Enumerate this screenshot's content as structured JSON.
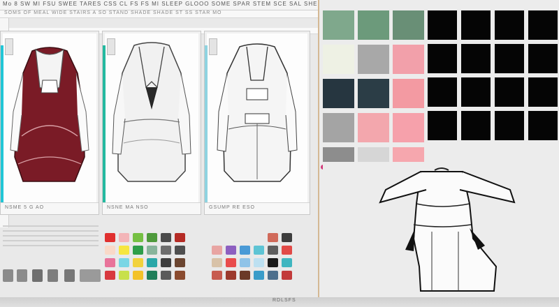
{
  "header": {
    "title_line": "Mo 8 SW MI FSU SWEE TARES CSS CL FS FS MI SLEEP GLOOO SOME SPAR STEM SCE SAL SHE",
    "subtitle_line": "SOMS OF MEAL WIDE STAIRS A SO STAND SHADE SHADE ST SS STAR MO"
  },
  "panels": [
    {
      "name": "burgundy-dress-sketch",
      "caption": "NSME 5 G AO",
      "accent": "#21c6d6",
      "fill": "#7a1b26"
    },
    {
      "name": "white-blazer-dress-sketch",
      "caption": "NSNE MA NSO",
      "accent": "#23b9a0",
      "fill": "#efefef"
    },
    {
      "name": "white-belted-dress-sketch",
      "caption": "GSUMP RE ESO",
      "accent": "#8fd3e0",
      "fill": "#f5f5f5"
    }
  ],
  "footer": {
    "label": "RDLSFS"
  },
  "palette_left": {
    "colors": [
      "#e0302f",
      "#f3b5b8",
      "#75c043",
      "#4f9a3c",
      "#4b4b4b",
      "#b52b25",
      "#f9d9c8",
      "#f6e640",
      "#2e9e4a",
      "#88b49b",
      "#6d6d6d",
      "#4f4f4f",
      "#e8739a",
      "#7ad6e5",
      "#f2d23d",
      "#2aa7a8",
      "#3e3e3e",
      "#6b4530",
      "#d8393f",
      "#c8e04a",
      "#f3c229",
      "#1f7f5a",
      "#5a5a5a",
      "#8a4b2f"
    ]
  },
  "palette_right": {
    "colors": [
      "#e9e9e9",
      "#e9e9e9",
      "#e9e9e9",
      "#e9e9e9",
      "#d06a5a",
      "#3d3d3d",
      "#e8a5a3",
      "#8d5fc0",
      "#4a9ad6",
      "#5ec4d4",
      "#5e5e5e",
      "#e14a47",
      "#d8c2a8",
      "#e94c4c",
      "#8fc3e8",
      "#bde0f1",
      "#1a1a1a",
      "#3fb6c0",
      "#c75b4f",
      "#9c3a2d",
      "#6b3a28",
      "#3a9cc9",
      "#4c6f8d",
      "#c23a3a"
    ]
  },
  "swatches_right": {
    "colors": [
      "#7fa88c",
      "#6c9a7b",
      "#698f76",
      "#eef1e4",
      "#a8a8a8",
      "#f2a0aa",
      "#263640",
      "#2b3d46",
      "#f39aa2",
      "#a4a4a4",
      "#f3a7ad",
      "#f6a1ab",
      "#8d8d8d",
      "#d6d6d6",
      "#f6a7ae"
    ]
  },
  "colors": {
    "accent_border": "#d4b894",
    "marker_magenta": "#d23a7a",
    "marker_yellow": "#f2cf52"
  }
}
